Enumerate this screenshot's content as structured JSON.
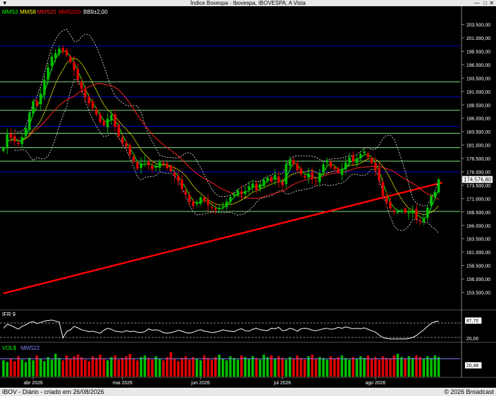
{
  "window": {
    "title": "Índice Bovespa - Ibovespa, IBOVESPA, A Vista",
    "menu_glyph": "▼",
    "close_glyph": "✕",
    "max_glyph": "□",
    "min_glyph": "—"
  },
  "footer": {
    "left": "IBOV - Diário - criado em 26/08/2026",
    "right": "© 2026 Broadcast"
  },
  "colors": {
    "up": "#00c000",
    "down": "#e00000",
    "mms3": "#00ff00",
    "mms8": "#ffff00",
    "mms20": "#ff2020",
    "mms200": "#ff0000",
    "bb": "#ffffff",
    "hline_blue": "#0000cc",
    "hline_green": "#80e080",
    "price_box": "#ffffff"
  },
  "chart_data": [
    {
      "type": "candlestick",
      "legend": [
        "MMS3",
        "MMS8",
        "MMS20",
        "MMS200",
        "BB9±2,00"
      ],
      "y_ticks": [
        "153.500,00",
        "156.000,00",
        "158.500,00",
        "161.000,00",
        "163.500,00",
        "166.000,00",
        "168.500,00",
        "171.000,00",
        "173.500,00",
        "176.000,00",
        "178.500,00",
        "181.000,00",
        "183.500,00",
        "186.000,00",
        "188.500,00",
        "191.000,00",
        "193.500,00",
        "196.000,00",
        "198.500,00",
        "201.000,00",
        "203.500,00"
      ],
      "ylim": [
        151500,
        205000
      ],
      "last_price_label": "174.576,80",
      "last_price": 174577,
      "h_lines_blue": [
        199500,
        190000,
        184500,
        176000
      ],
      "h_lines_green": [
        192800,
        187500,
        183200,
        180500,
        178000,
        168600
      ],
      "mms200_endpoints": [
        [
          0,
          153300
        ],
        [
          118,
          174000
        ]
      ],
      "closes": [
        180500,
        183000,
        182300,
        181700,
        181200,
        182500,
        184200,
        187000,
        189200,
        188300,
        190600,
        193200,
        195500,
        197500,
        198200,
        199000,
        198400,
        197800,
        196500,
        195000,
        193200,
        191500,
        189900,
        188800,
        187900,
        186700,
        185300,
        184700,
        185900,
        186600,
        184400,
        182700,
        181400,
        180700,
        179200,
        177900,
        176600,
        177600,
        178100,
        177200,
        176500,
        177100,
        177800,
        177400,
        176700,
        176100,
        175200,
        174300,
        172800,
        171800,
        170400,
        169600,
        170300,
        171200,
        170500,
        169800,
        169300,
        168900,
        169200,
        169700,
        170400,
        171300,
        171900,
        172500,
        171800,
        172400,
        173300,
        173800,
        172600,
        173700,
        174500,
        174900,
        174200,
        175400,
        174000,
        173500,
        177500,
        178300,
        177400,
        176300,
        175500,
        174900,
        175700,
        174700,
        174200,
        175800,
        177400,
        178100,
        176900,
        176500,
        175800,
        176600,
        177700,
        178700,
        177900,
        178500,
        179300,
        179800,
        178700,
        177600,
        176300,
        174400,
        171500,
        170200,
        169200,
        168600,
        168500,
        168800,
        168400,
        168300,
        168800,
        167200,
        166800,
        167300,
        169300,
        171500,
        172200,
        174577
      ],
      "x_labels": [
        {
          "i": 8,
          "text": "abr 2026"
        },
        {
          "i": 32,
          "text": "mai 2026"
        },
        {
          "i": 53,
          "text": "jun 2026"
        },
        {
          "i": 75,
          "text": "jul 2026"
        },
        {
          "i": 100,
          "text": "ago 2026"
        }
      ]
    },
    {
      "type": "line",
      "name": "IFR 9",
      "title": "IFR 9",
      "value_label": "87,70",
      "y_ticks": [
        "20,00"
      ],
      "upper_level": 80,
      "lower_level": 20,
      "last_value": 87.7,
      "values": [
        58,
        75,
        70,
        62,
        55,
        66,
        72,
        82,
        86,
        78,
        82,
        88,
        90,
        92,
        88,
        84,
        18,
        45,
        52,
        66,
        60,
        52,
        48,
        44,
        46,
        42,
        38,
        50,
        58,
        54,
        46,
        44,
        42,
        48,
        44,
        46,
        42,
        40,
        44,
        56,
        50,
        52,
        48,
        40,
        38,
        40,
        44,
        50,
        46,
        40,
        38,
        42,
        48,
        52,
        46,
        44,
        40,
        42,
        46,
        52,
        48,
        46,
        44,
        52,
        56,
        48,
        46,
        54,
        58,
        52,
        50,
        48,
        58,
        56,
        62,
        48,
        50,
        58,
        54,
        46,
        56,
        58,
        56,
        50,
        48,
        52,
        56,
        58,
        54,
        56,
        62,
        58,
        64,
        60,
        56,
        58,
        56,
        60,
        54,
        48,
        42,
        30,
        20,
        16,
        14,
        14,
        14,
        14,
        14,
        16,
        20,
        28,
        40,
        52,
        66,
        78,
        86,
        87.7
      ]
    },
    {
      "type": "bar",
      "name": "VOL$",
      "legend": [
        "VOL$",
        "MMS22"
      ],
      "value_label": "20,48",
      "mms22_level": 22,
      "values": [
        20,
        18,
        22,
        19,
        25,
        21,
        18,
        23,
        20,
        26,
        22,
        19,
        24,
        21,
        28,
        23,
        20,
        26,
        22,
        25,
        27,
        24,
        21,
        19,
        25,
        23,
        27,
        22,
        20,
        24,
        26,
        21,
        23,
        25,
        28,
        22,
        20,
        24,
        26,
        23,
        21,
        25,
        22,
        20,
        24,
        30,
        22,
        19,
        23,
        25,
        21,
        24,
        22,
        20,
        26,
        23,
        21,
        24,
        27,
        22,
        20,
        25,
        23,
        21,
        26,
        24,
        22,
        25,
        23,
        21,
        27,
        24,
        26,
        22,
        25,
        23,
        21,
        24,
        22,
        26,
        23,
        21,
        25,
        27,
        22,
        24,
        23,
        21,
        25,
        22,
        24,
        26,
        23,
        21,
        24,
        22,
        25,
        23,
        26,
        22,
        24,
        21,
        25,
        23,
        22,
        26,
        28,
        24,
        22,
        25,
        23,
        26,
        24,
        22,
        25,
        23,
        26,
        24
      ]
    }
  ]
}
